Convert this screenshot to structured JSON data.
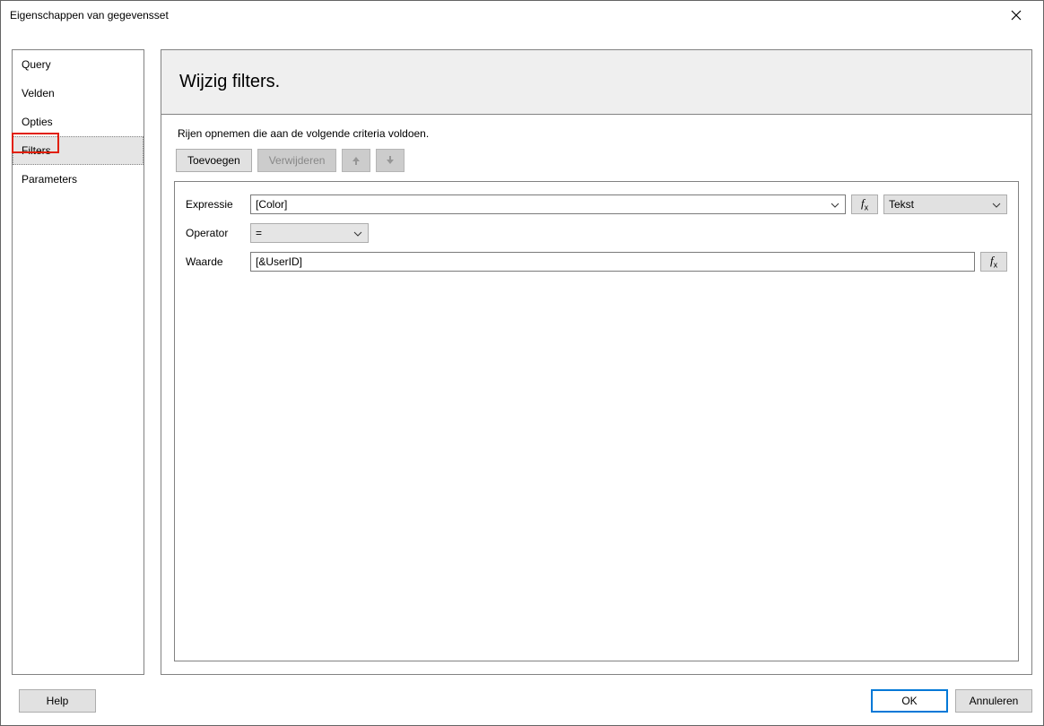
{
  "window": {
    "title": "Eigenschappen van gegevensset"
  },
  "sidebar": {
    "items": [
      {
        "label": "Query"
      },
      {
        "label": "Velden"
      },
      {
        "label": "Opties"
      },
      {
        "label": "Filters"
      },
      {
        "label": "Parameters"
      }
    ]
  },
  "page": {
    "heading": "Wijzig filters.",
    "instruction": "Rijen opnemen die aan de volgende criteria voldoen."
  },
  "toolbar": {
    "add": "Toevoegen",
    "delete": "Verwijderen"
  },
  "form": {
    "expression_label": "Expressie",
    "expression_value": "[Color]",
    "type_value": "Tekst",
    "operator_label": "Operator",
    "operator_value": "=",
    "value_label": "Waarde",
    "value_value": "[&UserID]"
  },
  "footer": {
    "help": "Help",
    "ok": "OK",
    "cancel": "Annuleren"
  }
}
